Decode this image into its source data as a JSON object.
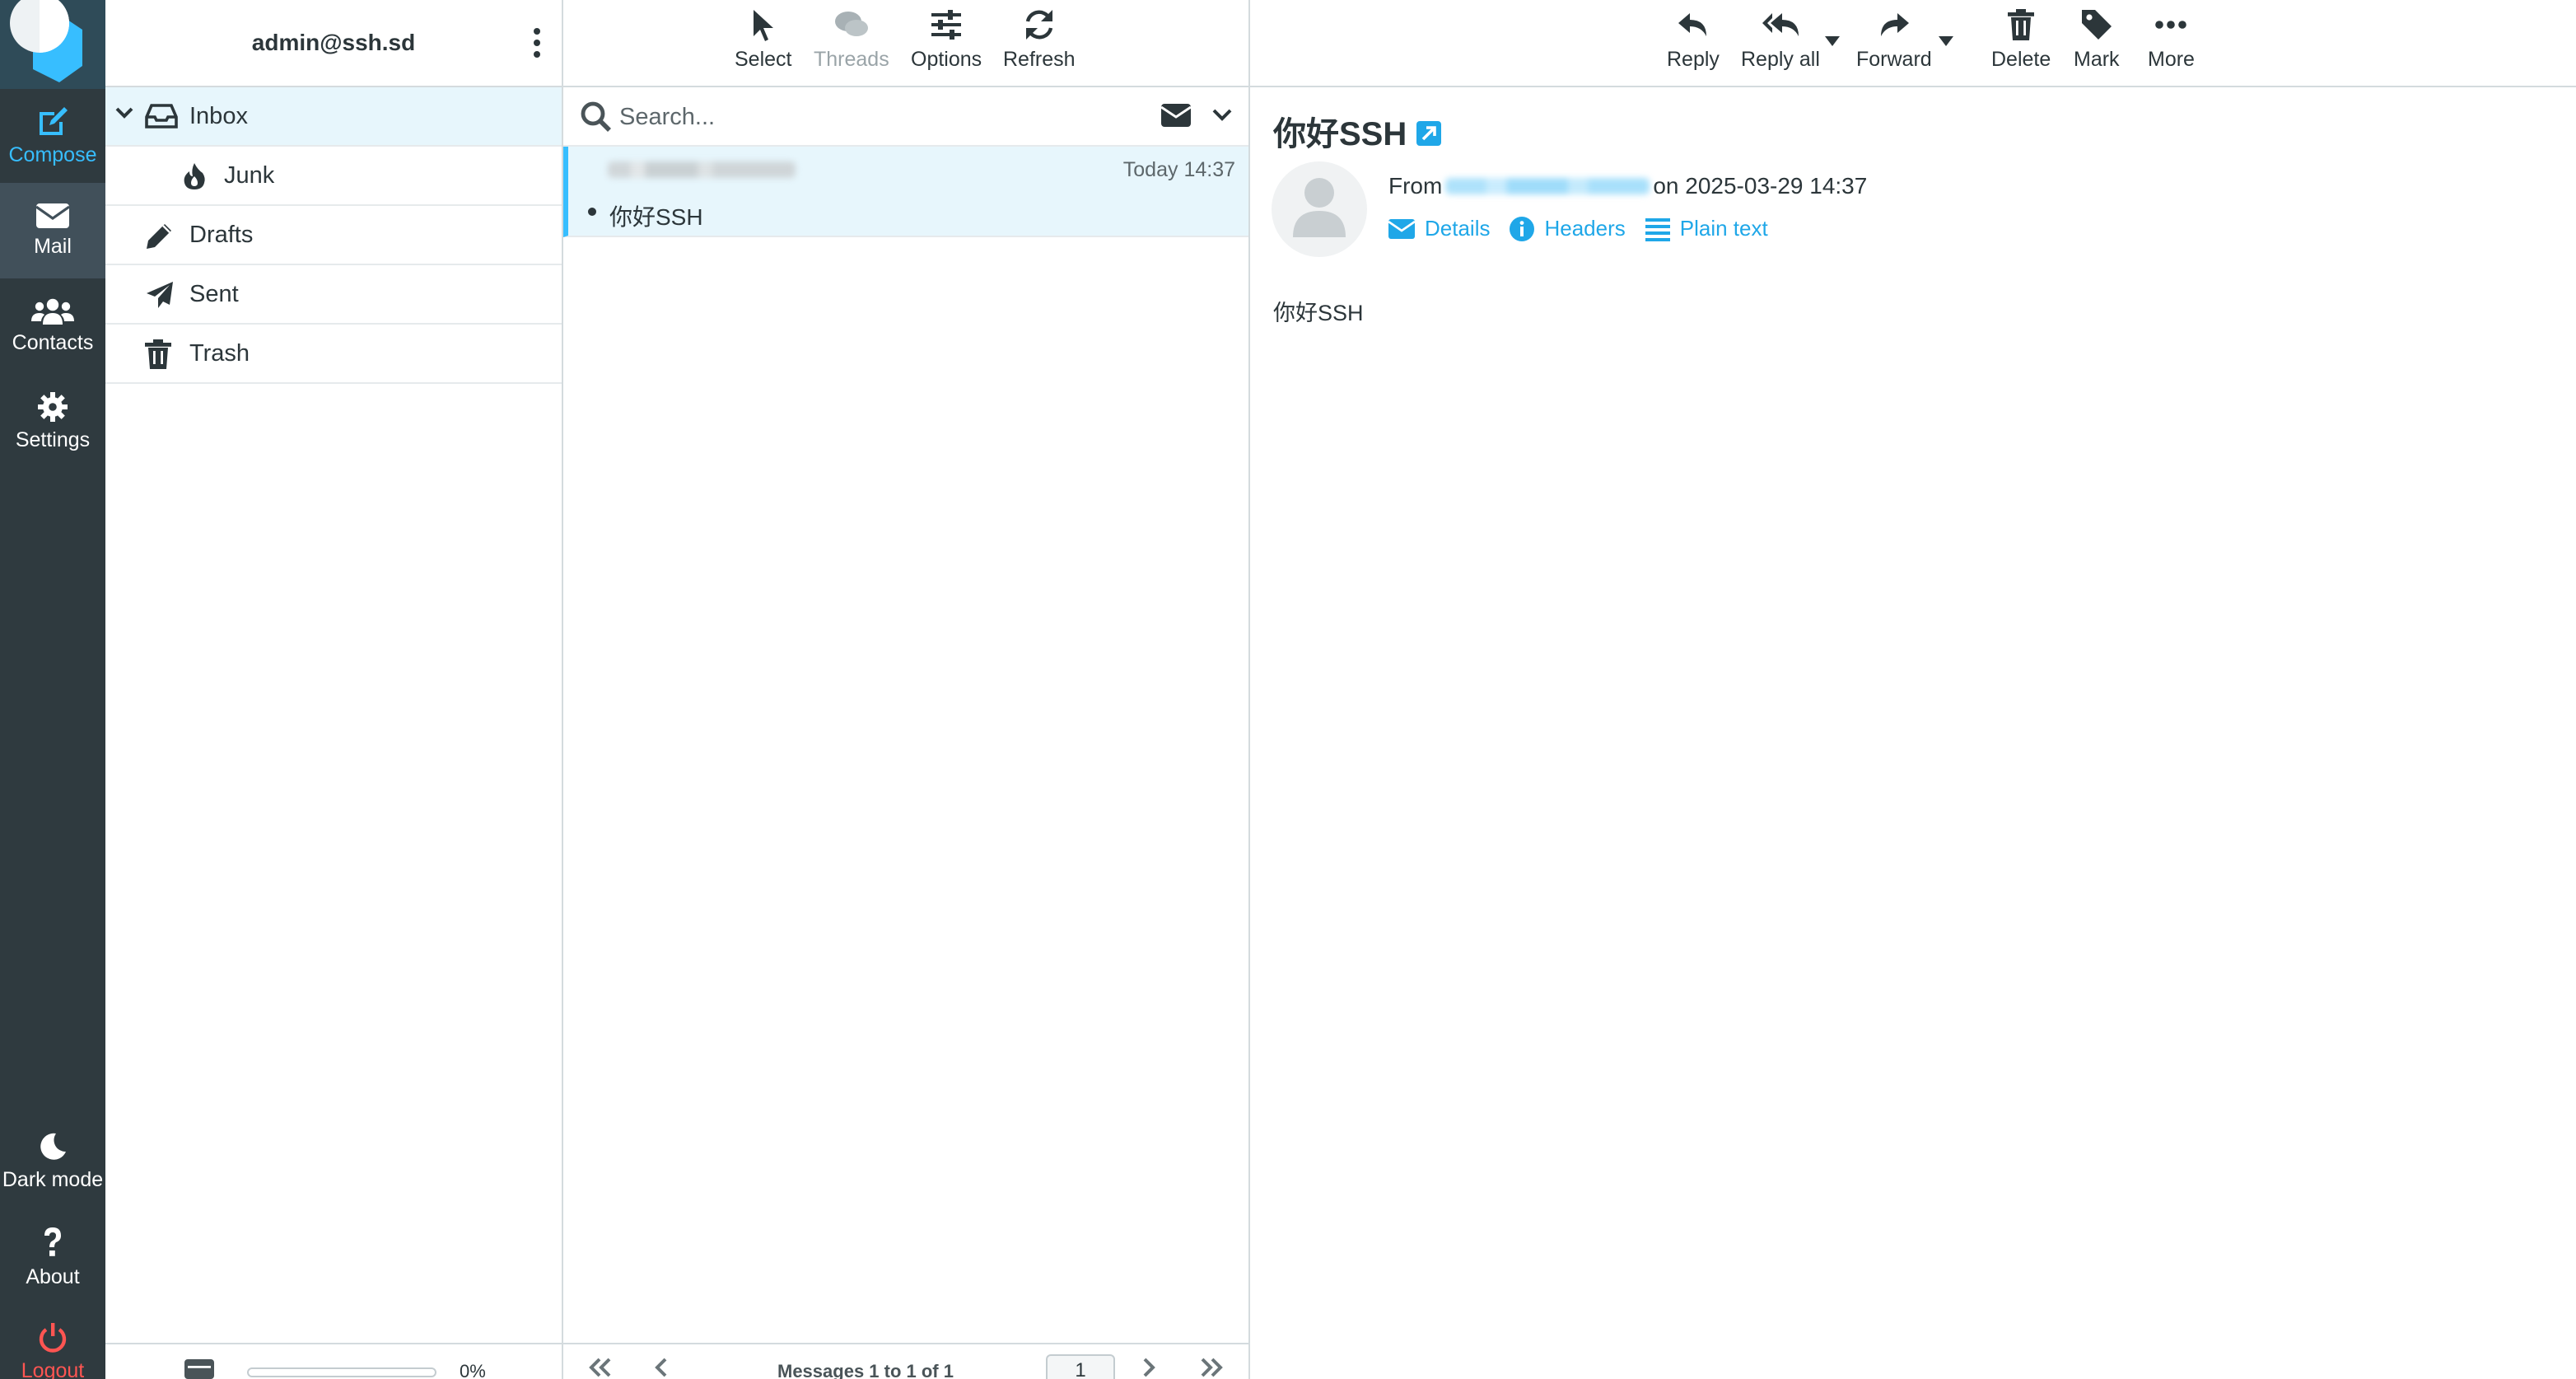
{
  "app": {
    "name": "Roundcube Webmail",
    "accent": "#37beff"
  },
  "taskmenu": {
    "compose": "Compose",
    "mail": "Mail",
    "contacts": "Contacts",
    "settings": "Settings",
    "darkmode": "Dark mode",
    "about": "About",
    "logout": "Logout"
  },
  "account": {
    "email": "admin@ssh.sd"
  },
  "folders": [
    {
      "label": "Inbox",
      "icon": "inbox-icon",
      "selected": true
    },
    {
      "label": "Junk",
      "icon": "fire-icon",
      "selected": false
    },
    {
      "label": "Drafts",
      "icon": "pencil-icon",
      "selected": false
    },
    {
      "label": "Sent",
      "icon": "paper-plane-icon",
      "selected": false
    },
    {
      "label": "Trash",
      "icon": "trash-icon",
      "selected": false
    }
  ],
  "quota": {
    "percent_label": "0%",
    "fraction": 0.0
  },
  "list_toolbar": {
    "select": "Select",
    "threads": "Threads",
    "options": "Options",
    "refresh": "Refresh"
  },
  "search": {
    "placeholder": "Search..."
  },
  "messages": [
    {
      "date": "Today 14:37",
      "subject": "你好SSH",
      "unread": true
    }
  ],
  "pagination": {
    "count_text": "Messages 1 to 1 of 1",
    "page": "1"
  },
  "view_toolbar": {
    "reply": "Reply",
    "reply_all": "Reply all",
    "forward": "Forward",
    "delete": "Delete",
    "mark": "Mark",
    "more": "More"
  },
  "message": {
    "subject": "你好SSH",
    "from_label": "From",
    "date_text": "on 2025-03-29 14:37",
    "links": {
      "details": "Details",
      "headers": "Headers",
      "plain": "Plain text"
    },
    "body": "你好SSH"
  }
}
